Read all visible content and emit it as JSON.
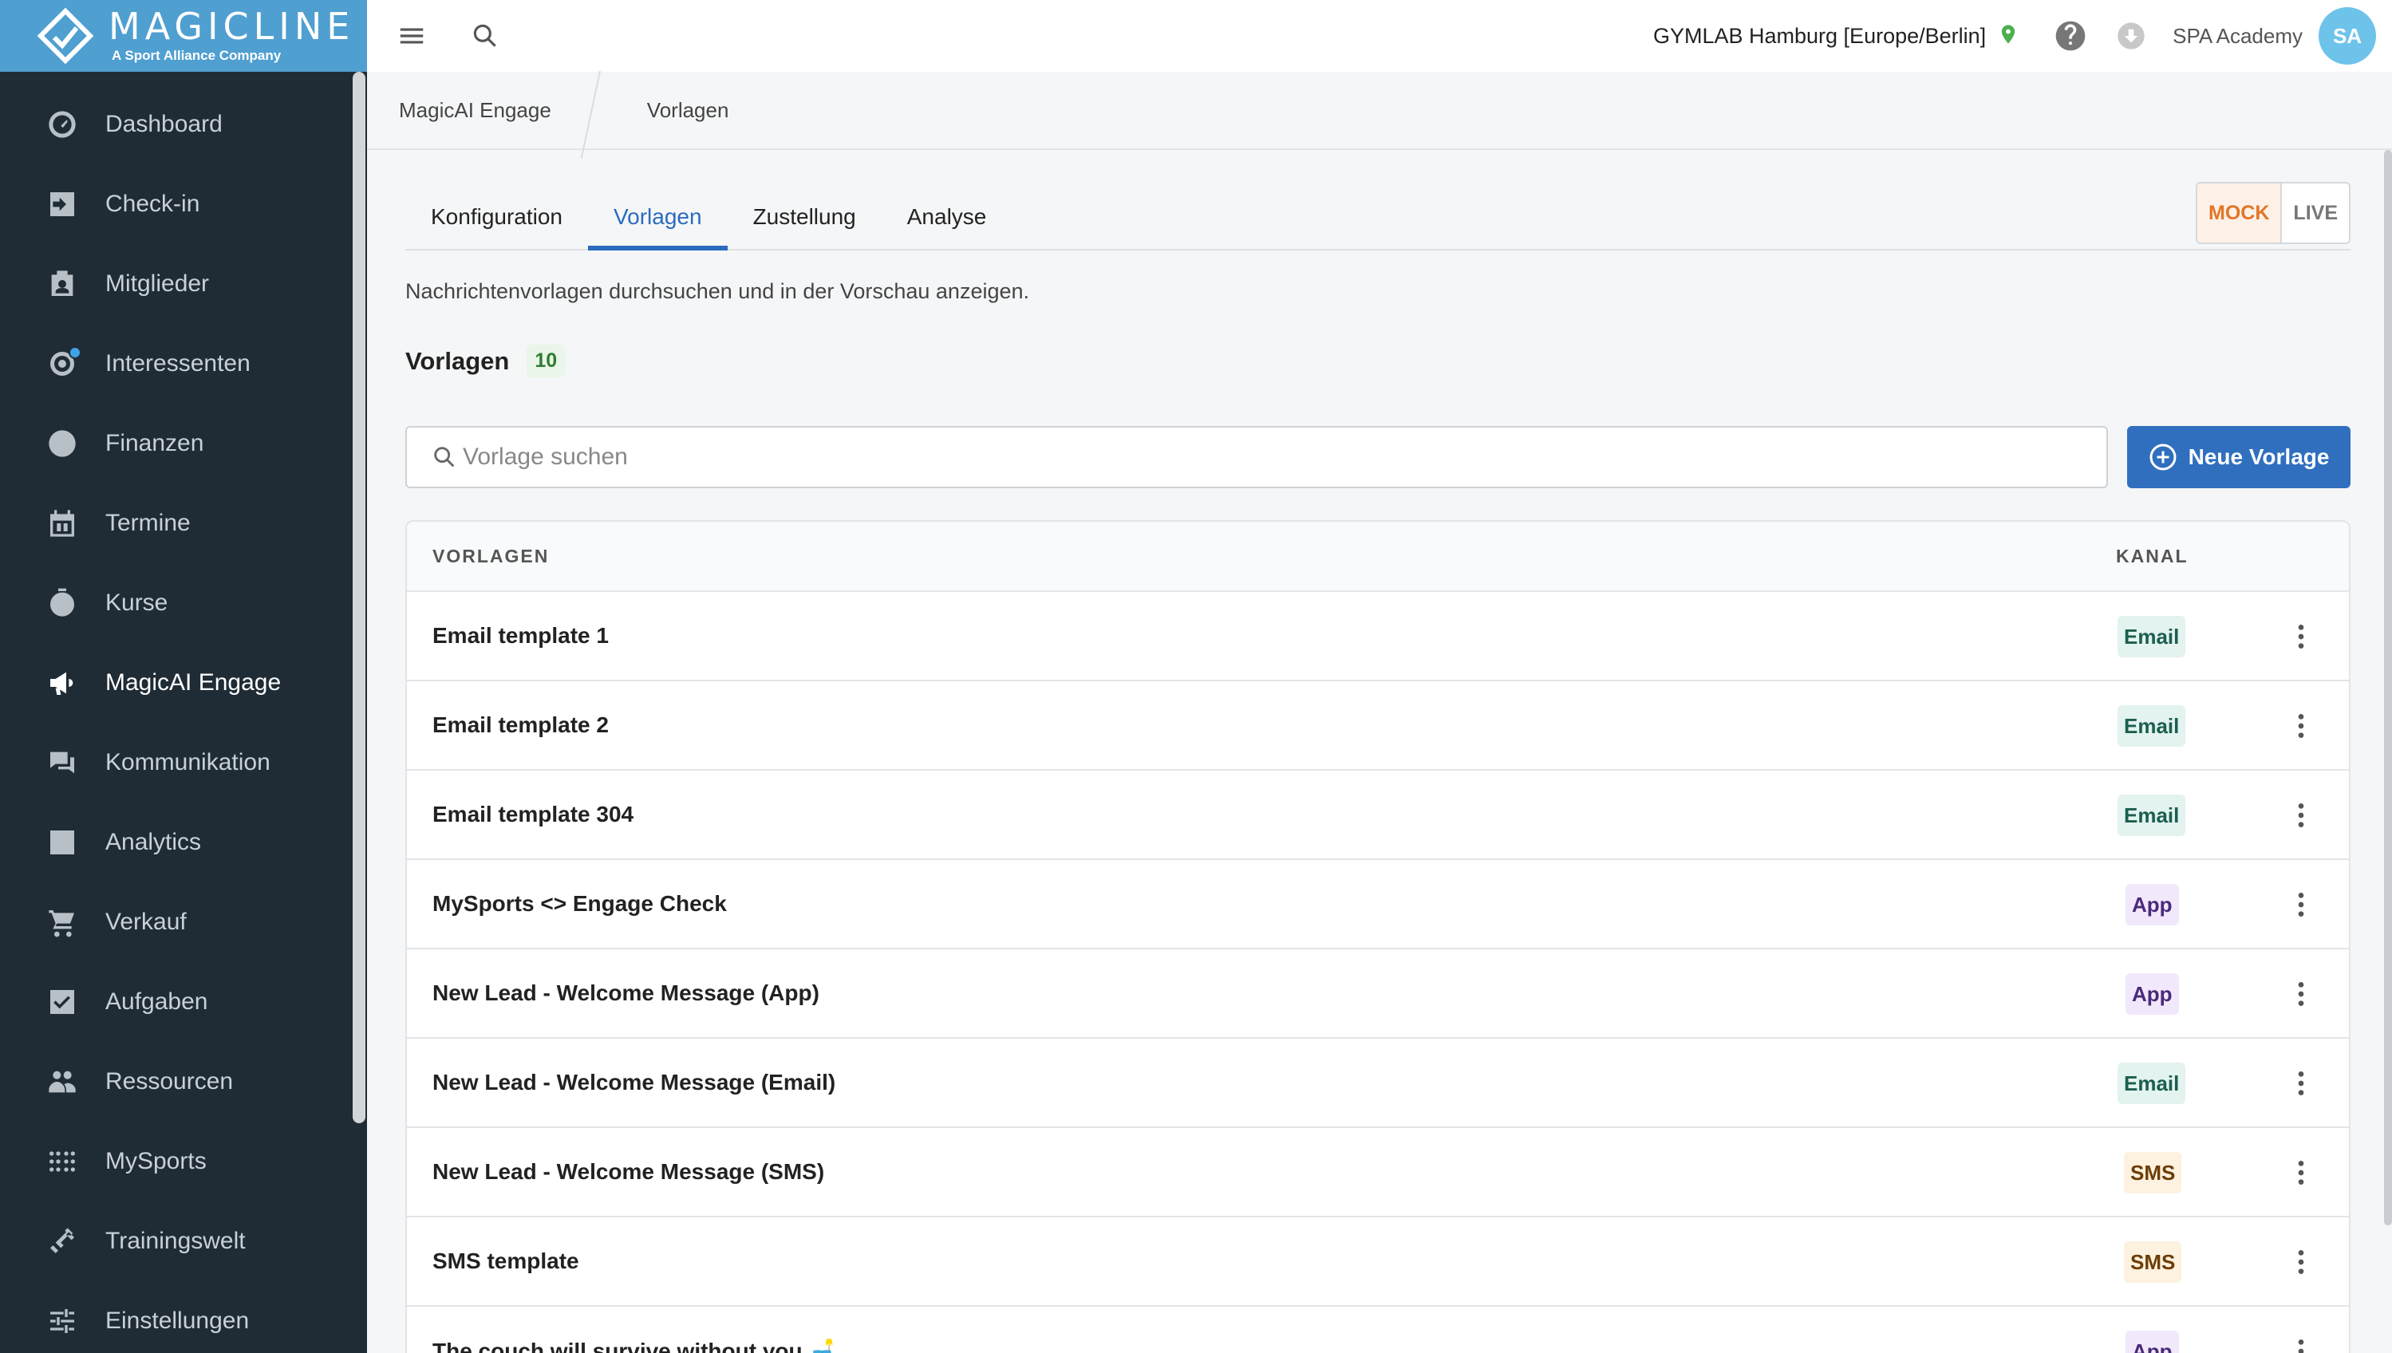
{
  "brand": {
    "name": "MAGICLINE",
    "tagline": "A Sport Alliance Company"
  },
  "sidebar": {
    "items": [
      {
        "label": "Dashboard",
        "icon": "dashboard-icon"
      },
      {
        "label": "Check-in",
        "icon": "check-in-icon"
      },
      {
        "label": "Mitglieder",
        "icon": "members-icon"
      },
      {
        "label": "Interessenten",
        "icon": "leads-icon"
      },
      {
        "label": "Finanzen",
        "icon": "euro-icon"
      },
      {
        "label": "Termine",
        "icon": "calendar-icon"
      },
      {
        "label": "Kurse",
        "icon": "stopwatch-icon"
      },
      {
        "label": "MagicAI Engage",
        "icon": "megaphone-icon"
      },
      {
        "label": "Kommunikation",
        "icon": "chat-icon"
      },
      {
        "label": "Analytics",
        "icon": "chart-icon"
      },
      {
        "label": "Verkauf",
        "icon": "cart-icon"
      },
      {
        "label": "Aufgaben",
        "icon": "task-check-icon"
      },
      {
        "label": "Ressourcen",
        "icon": "group-icon"
      },
      {
        "label": "MySports",
        "icon": "dots-grid-icon"
      },
      {
        "label": "Trainingswelt",
        "icon": "dumbbell-icon"
      },
      {
        "label": "Einstellungen",
        "icon": "sliders-icon"
      }
    ],
    "active_index": 7
  },
  "topbar": {
    "studio": "GYMLAB Hamburg [Europe/Berlin]",
    "organization": "SPA Academy",
    "avatar_initials": "SA"
  },
  "breadcrumb": {
    "first": "MagicAI Engage",
    "second": "Vorlagen"
  },
  "tabs": [
    {
      "label": "Konfiguration"
    },
    {
      "label": "Vorlagen"
    },
    {
      "label": "Zustellung"
    },
    {
      "label": "Analyse"
    }
  ],
  "active_tab": 1,
  "mode": {
    "mock": "MOCK",
    "live": "LIVE",
    "selected": "MOCK"
  },
  "description": "Nachrichtenvorlagen durchsuchen und in der Vorschau anzeigen.",
  "section": {
    "title": "Vorlagen",
    "count": "10"
  },
  "search": {
    "placeholder": "Vorlage suchen",
    "value": ""
  },
  "new_button": {
    "label": "Neue Vorlage"
  },
  "table": {
    "headers": {
      "name": "VORLAGEN",
      "channel": "KANAL"
    },
    "rows": [
      {
        "name": "Email template 1",
        "channel": "Email"
      },
      {
        "name": "Email template 2",
        "channel": "Email"
      },
      {
        "name": "Email template 304",
        "channel": "Email"
      },
      {
        "name": "MySports <> Engage Check",
        "channel": "App"
      },
      {
        "name": "New Lead - Welcome Message (App)",
        "channel": "App"
      },
      {
        "name": "New Lead - Welcome Message (Email)",
        "channel": "Email"
      },
      {
        "name": "New Lead - Welcome Message (SMS)",
        "channel": "SMS"
      },
      {
        "name": "SMS template",
        "channel": "SMS"
      },
      {
        "name": "The couch will survive without you 🛋️",
        "channel": "App"
      }
    ]
  },
  "colors": {
    "sidebar_bg": "#1f2c36",
    "brand_bg": "#4f9fd0",
    "accent": "#2a6bbf",
    "mock": "#e0762a"
  }
}
